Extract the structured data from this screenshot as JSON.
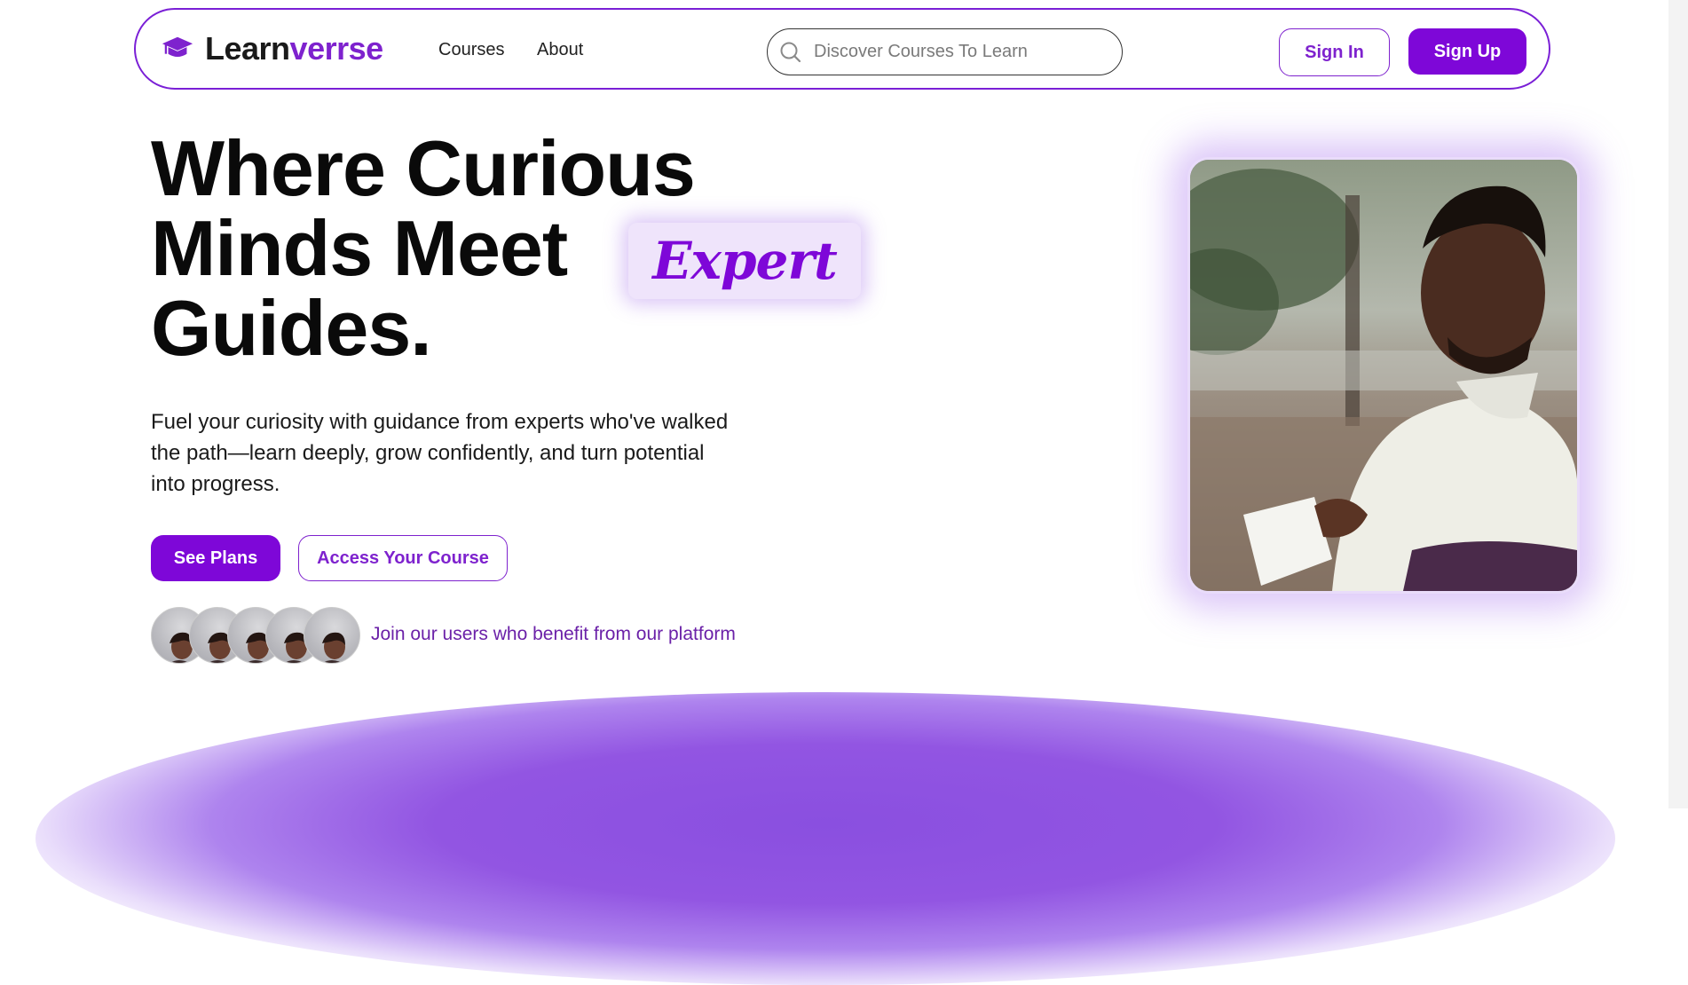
{
  "brand": {
    "name_part1": "Learn",
    "name_part2": "verrse",
    "accent_color": "#7e07d8",
    "logo_icon": "graduation-cap-icon"
  },
  "nav": {
    "links": [
      {
        "label": "Courses"
      },
      {
        "label": "About"
      }
    ],
    "search": {
      "placeholder": "Discover Courses To Learn",
      "icon": "search-icon"
    },
    "sign_in_label": "Sign In",
    "sign_up_label": "Sign Up"
  },
  "hero": {
    "title_line1": "Where Curious",
    "title_line2": "Minds Meet",
    "title_highlight": "Expert",
    "title_line3": "Guides.",
    "description": "Fuel your curiosity with guidance from experts who've walked the path—learn deeply, grow confidently, and turn potential into progress.",
    "primary_button_label": "See Plans",
    "secondary_button_label": "Access Your Course",
    "avatars_caption": "Join our users who benefit from our platform"
  }
}
